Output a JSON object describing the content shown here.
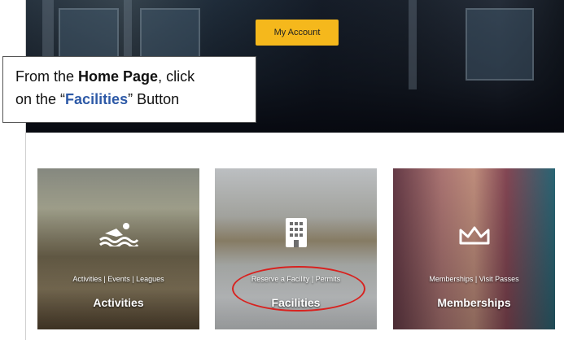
{
  "header": {
    "account_button_label": "My Account"
  },
  "callout": {
    "line1_prefix": "From the ",
    "line1_bold": "Home Page",
    "line1_suffix": ", click",
    "line2_prefix": "on the “",
    "line2_blue": "Facilities",
    "line2_suffix": "” Button",
    "highlight_color": "#2e5aa7"
  },
  "cards": [
    {
      "icon": "swimmer-icon",
      "subtitle": "Activities | Events | Leagues",
      "title": "Activities"
    },
    {
      "icon": "building-icon",
      "subtitle": "Reserve a Facility | Permits",
      "title": "Facilities"
    },
    {
      "icon": "crown-icon",
      "subtitle": "Memberships | Visit Passes",
      "title": "Memberships"
    }
  ],
  "colors": {
    "accent": "#f5b81c",
    "annotation_red": "#d8221f"
  }
}
